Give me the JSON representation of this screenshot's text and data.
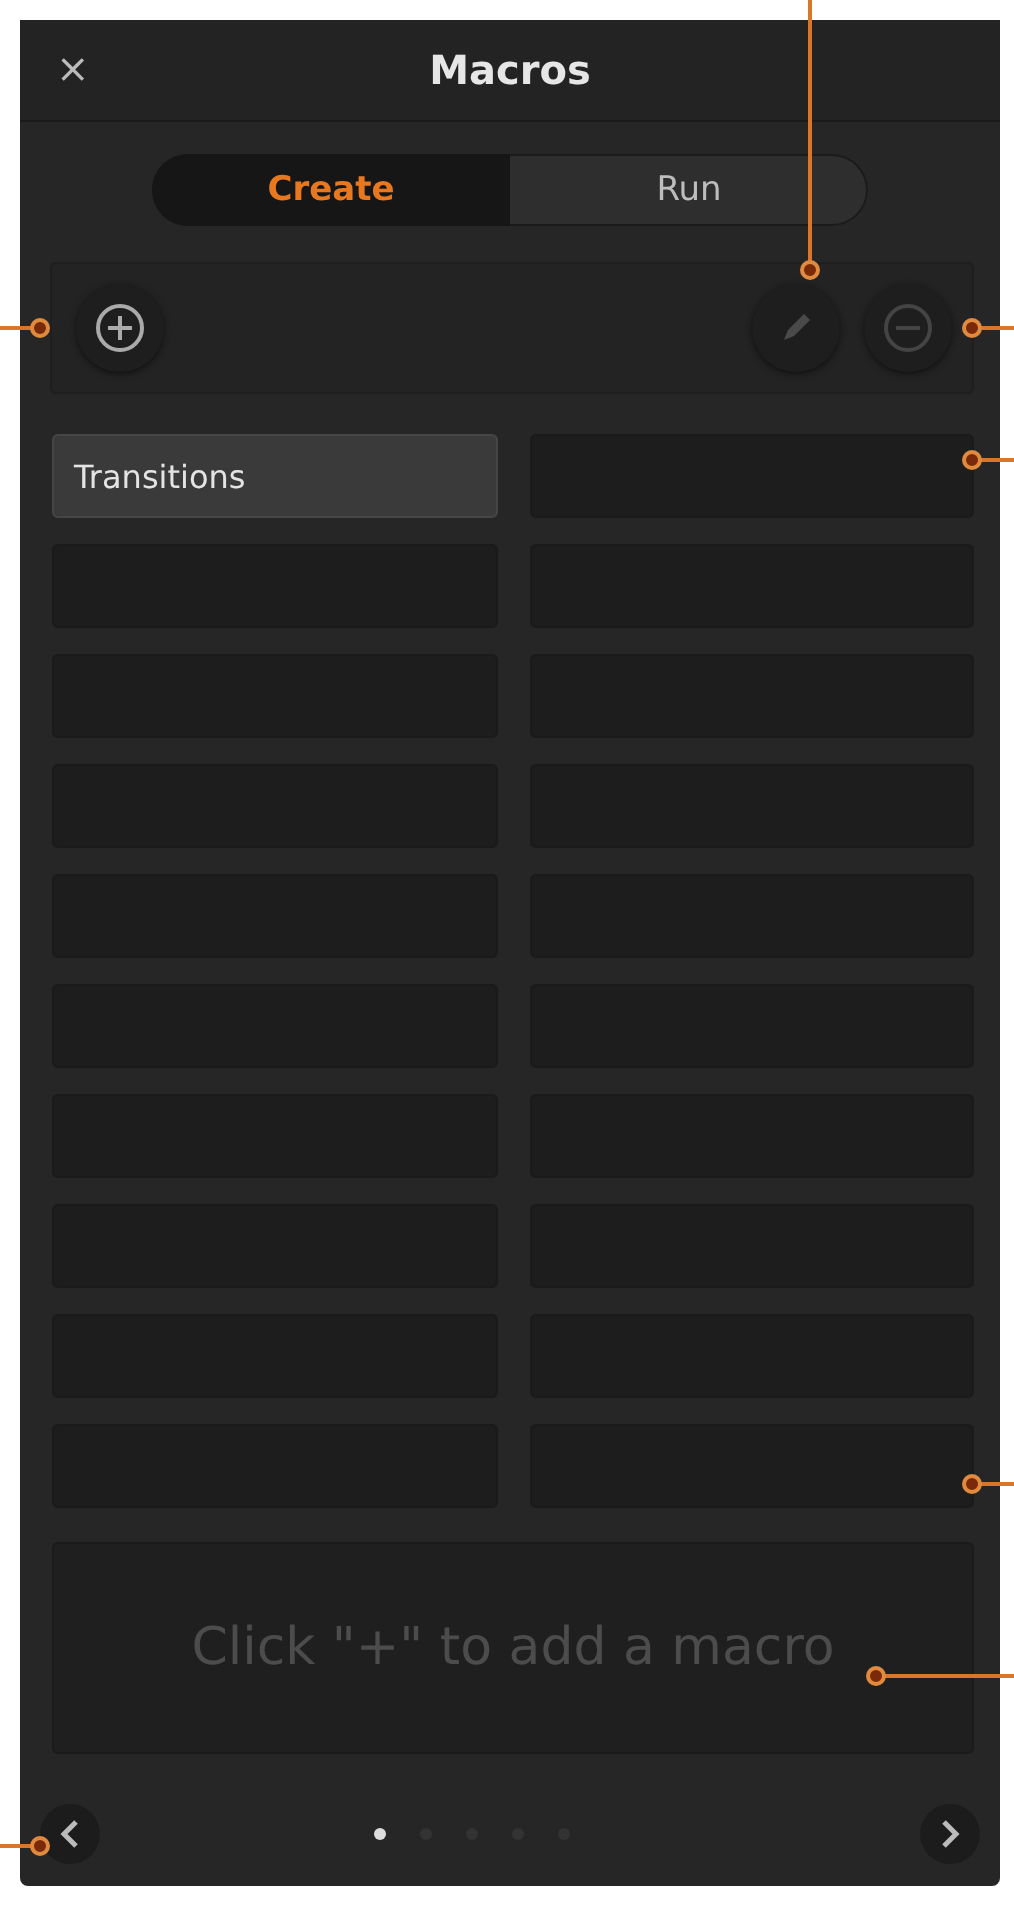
{
  "window": {
    "title": "Macros",
    "close": "×"
  },
  "tabs": [
    {
      "label": "Create",
      "selected": true
    },
    {
      "label": "Run",
      "selected": false
    }
  ],
  "slots": [
    {
      "filled": true,
      "label": "Transitions"
    },
    {
      "filled": false
    },
    {
      "filled": false
    },
    {
      "filled": false
    },
    {
      "filled": false
    },
    {
      "filled": false
    },
    {
      "filled": false
    },
    {
      "filled": false
    },
    {
      "filled": false
    },
    {
      "filled": false
    },
    {
      "filled": false
    },
    {
      "filled": false
    },
    {
      "filled": false
    },
    {
      "filled": false
    },
    {
      "filled": false
    },
    {
      "filled": false
    },
    {
      "filled": false
    },
    {
      "filled": false
    },
    {
      "filled": false
    },
    {
      "filled": false
    }
  ],
  "message": "Click \"+\" to add a macro",
  "pages": [
    {
      "selected": true
    },
    {
      "selected": false
    },
    {
      "selected": false
    },
    {
      "selected": false
    },
    {
      "selected": false
    }
  ]
}
